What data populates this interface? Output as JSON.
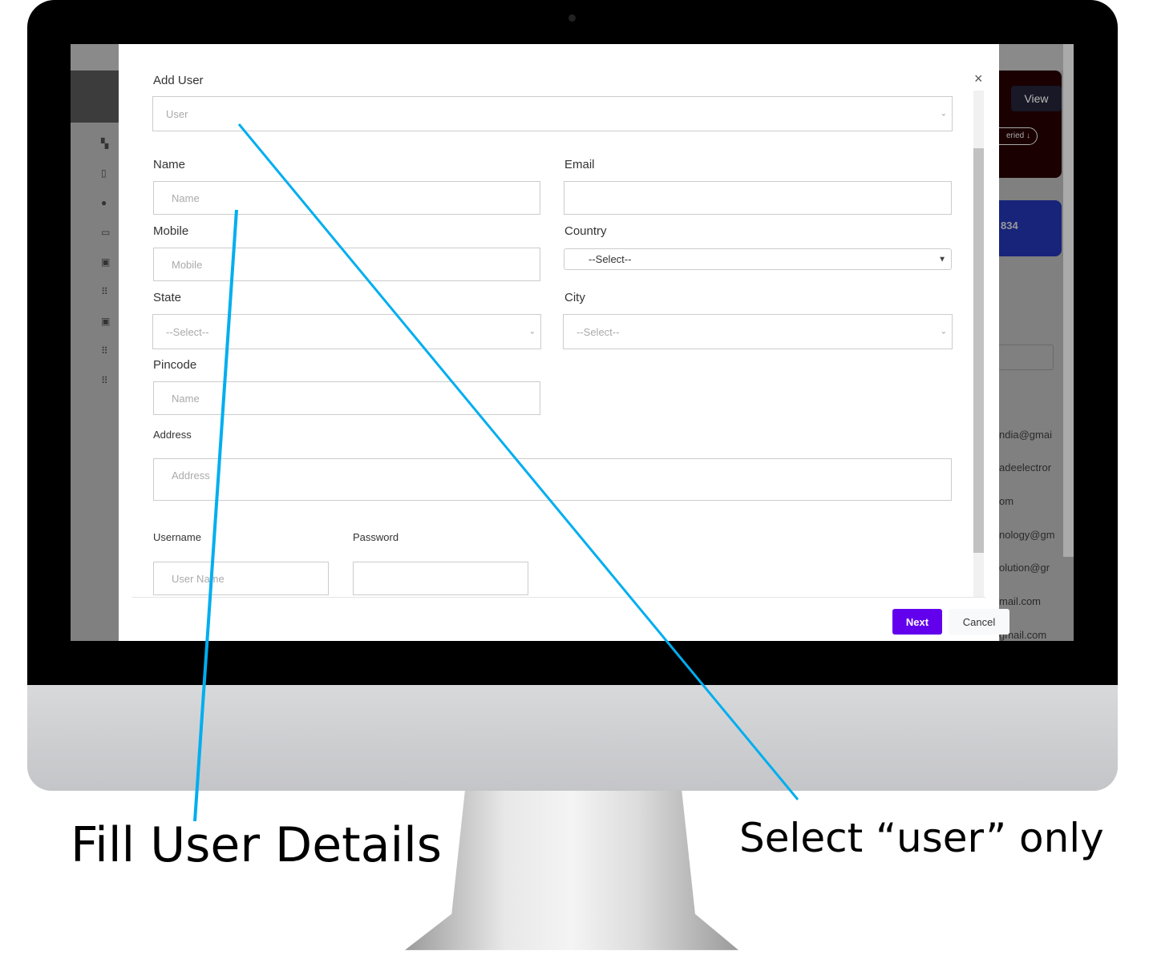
{
  "modal": {
    "title": "Add User",
    "role_select": {
      "placeholder": "User"
    },
    "fields": {
      "name": {
        "label": "Name",
        "placeholder": "Name"
      },
      "email": {
        "label": "Email",
        "value": ""
      },
      "mobile": {
        "label": "Mobile",
        "placeholder": "Mobile"
      },
      "country": {
        "label": "Country",
        "value": "--Select--"
      },
      "state": {
        "label": "State",
        "value": "--Select--"
      },
      "city": {
        "label": "City",
        "value": "--Select--"
      },
      "pincode": {
        "label": "Pincode",
        "placeholder": "Name"
      },
      "address": {
        "label": "Address",
        "placeholder": "Address"
      },
      "username": {
        "label": "Username",
        "placeholder": "User Name"
      },
      "password": {
        "label": "Password",
        "value": ""
      }
    },
    "close_icon": "×",
    "next_label": "Next",
    "cancel_label": "Cancel",
    "accent": "#6200ee"
  },
  "background_page": {
    "view_label": "View",
    "pill_label": "eried ↓",
    "card_value": "834",
    "emails": [
      "ndia@gmai",
      "adeelectror",
      "om",
      "nology@gm",
      "olution@gr",
      "mail.com",
      "gmail.com"
    ],
    "sidebar_icons": [
      "dashboard-icon",
      "map-icon",
      "user-circle-icon",
      "monitor-icon",
      "calendar-check-icon",
      "grid-icon",
      "calendar-check-icon",
      "grid-icon",
      "grid-icon"
    ]
  },
  "annotations": {
    "fill_details": "Fill User Details",
    "select_user": "Select “user” only",
    "line_color": "#00aeef"
  }
}
